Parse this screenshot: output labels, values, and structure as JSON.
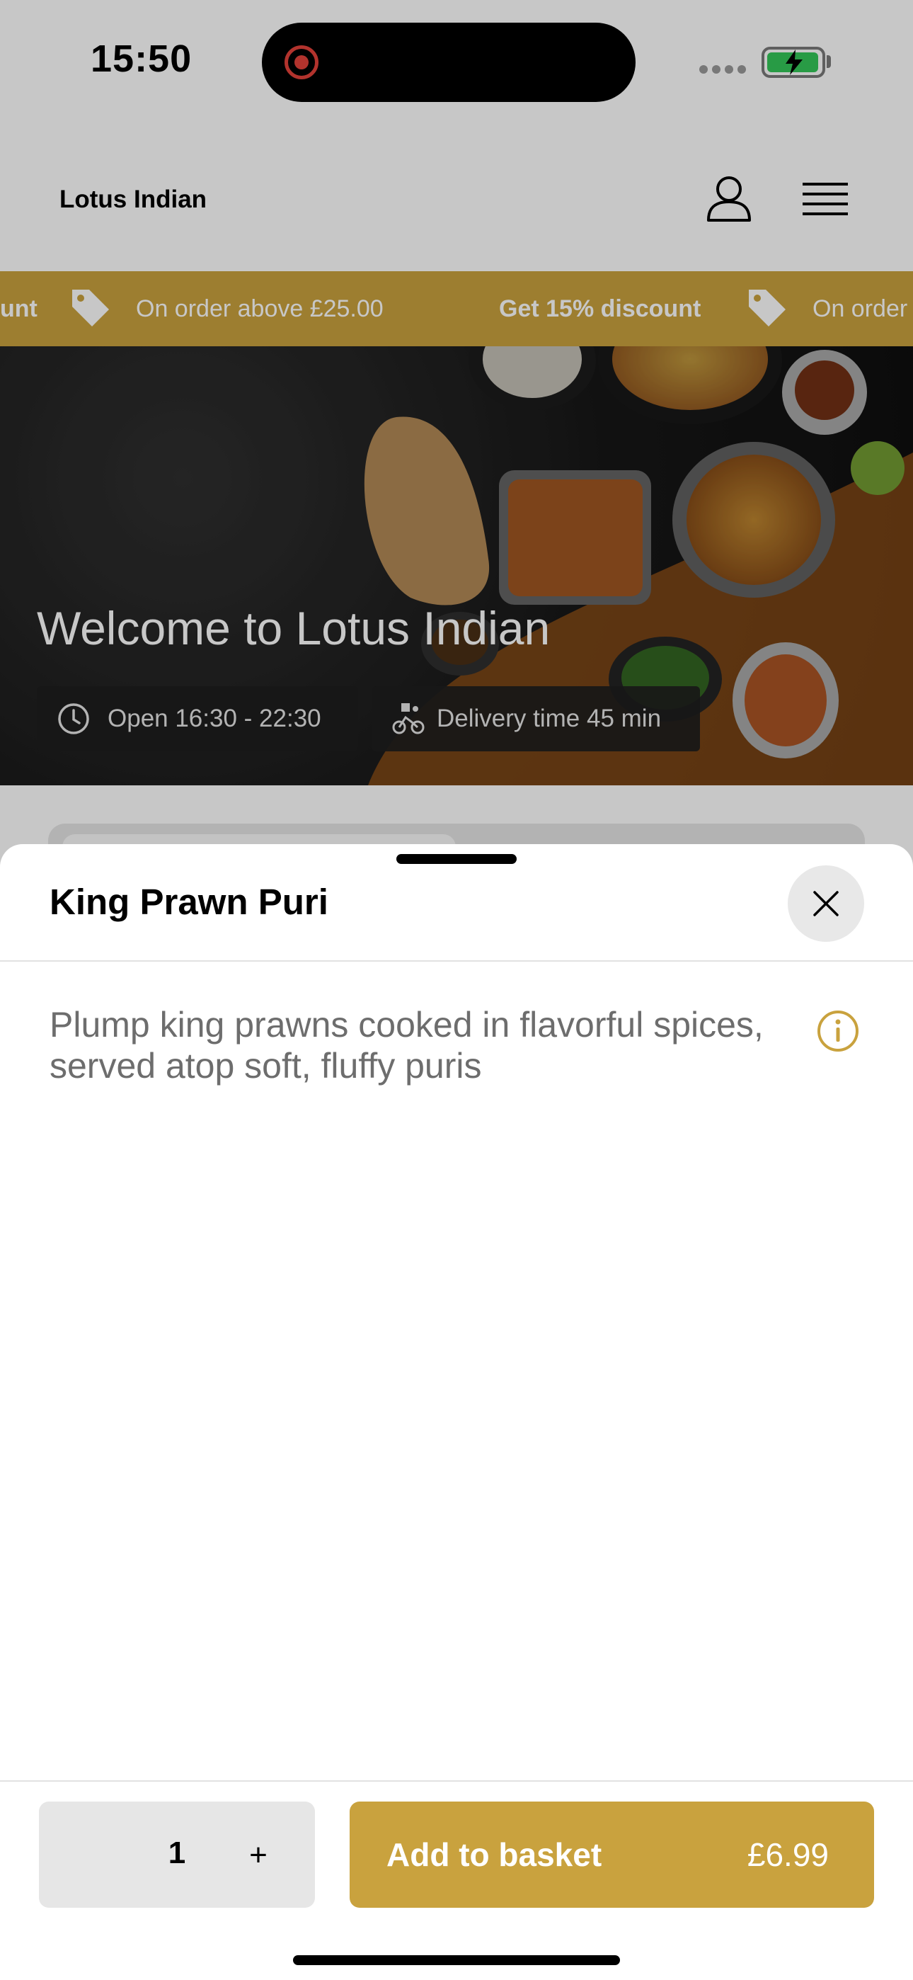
{
  "status_bar": {
    "time": "15:50"
  },
  "header": {
    "brand": "Lotus Indian"
  },
  "promo": {
    "items": [
      {
        "text": "unt",
        "bold": true
      },
      {
        "text": "On order above £25.00",
        "bold": false
      },
      {
        "text": "Get 15% discount",
        "bold": true
      },
      {
        "text": "On order",
        "bold": false
      }
    ],
    "color": "#c9a23e"
  },
  "hero": {
    "title": "Welcome to Lotus Indian",
    "open_hours": "Open 16:30 - 22:30",
    "delivery_time": "Delivery time 45 min"
  },
  "sheet": {
    "title": "King Prawn Puri",
    "description": "Plump king prawns cooked in flavorful spices, served atop soft, fluffy puris",
    "quantity": "1",
    "plus_label": "+",
    "add_label": "Add to basket",
    "price": "£6.99"
  },
  "icons": [
    "user-icon",
    "menu-icon",
    "tag-icon",
    "clock-icon",
    "bike-icon",
    "close-icon",
    "info-icon"
  ],
  "colors": {
    "accent": "#c9a23e",
    "battery": "#34c759",
    "record": "#e5423a"
  }
}
